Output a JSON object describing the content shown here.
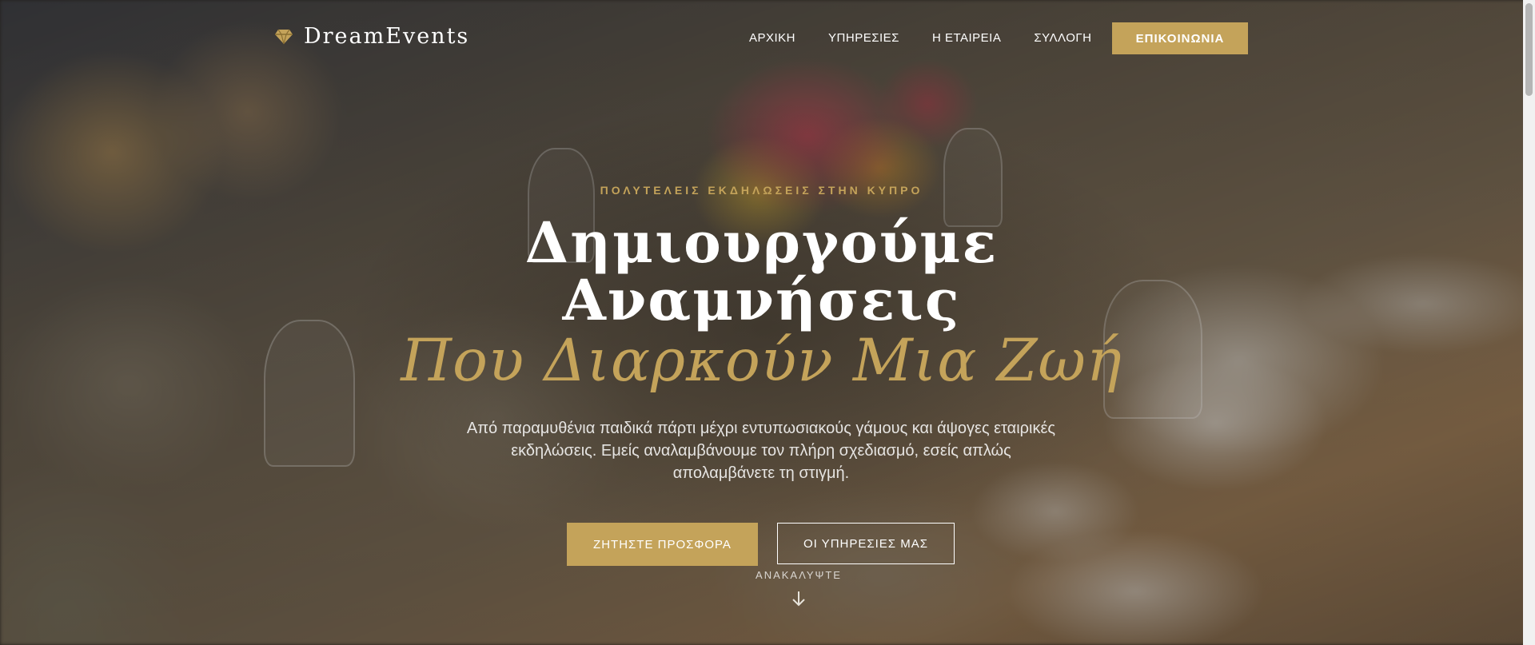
{
  "brand": {
    "name": "DreamEvents",
    "icon": "diamond-icon",
    "accent_color": "#c4a35a"
  },
  "nav": {
    "items": [
      {
        "label": "ΑΡΧΙΚΗ"
      },
      {
        "label": "ΥΠΗΡΕΣΙΕΣ"
      },
      {
        "label": "Η ΕΤΑΙΡΕΙΑ"
      },
      {
        "label": "ΣΥΛΛΟΓΗ"
      }
    ],
    "cta_label": "ΕΠΙΚΟΙΝΩΝΙΑ"
  },
  "hero": {
    "eyebrow": "ΠΟΛΥΤΕΛΕΙΣ ΕΚΔΗΛΩΣΕΙΣ ΣΤΗΝ ΚΥΠΡΟ",
    "title_line1": "Δημιουργούμε",
    "title_line2": "Αναμνήσεις",
    "title_accent": "Που Διαρκούν Μια Ζωή",
    "subtitle": "Από παραμυθένια παιδικά πάρτι μέχρι εντυπωσιακούς γάμους και άψογες εταιρικές εκδηλώσεις. Εμείς αναλαμβάνουμε τον πλήρη σχεδιασμό, εσείς απλώς απολαμβάνετε τη στιγμή.",
    "primary_button": "ΖΗΤΗΣΤΕ ΠΡΟΣΦΟΡΑ",
    "secondary_button": "ΟΙ ΥΠΗΡΕΣΙΕΣ ΜΑΣ",
    "scroll_hint": "ΑΝΑΚΑΛΥΨΤΕ",
    "scroll_icon": "arrow-down-icon"
  }
}
